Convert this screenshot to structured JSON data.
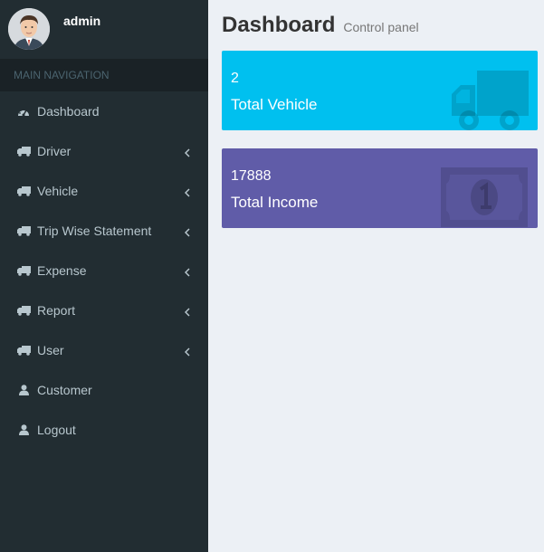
{
  "user": {
    "name": "admin"
  },
  "nav": {
    "header": "MAIN NAVIGATION",
    "items": [
      {
        "label": "Dashboard",
        "icon": "dashboard-icon",
        "has_children": false
      },
      {
        "label": "Driver",
        "icon": "truck-icon",
        "has_children": true
      },
      {
        "label": "Vehicle",
        "icon": "truck-icon",
        "has_children": true
      },
      {
        "label": "Trip Wise Statement",
        "icon": "truck-icon",
        "has_children": true
      },
      {
        "label": "Expense",
        "icon": "truck-icon",
        "has_children": true
      },
      {
        "label": "Report",
        "icon": "truck-icon",
        "has_children": true
      },
      {
        "label": "User",
        "icon": "truck-icon",
        "has_children": true
      },
      {
        "label": "Customer",
        "icon": "user-icon",
        "has_children": false
      },
      {
        "label": "Logout",
        "icon": "user-icon",
        "has_children": false
      }
    ]
  },
  "header": {
    "title": "Dashboard",
    "subtitle": "Control panel"
  },
  "boxes": [
    {
      "value": "2",
      "label": "Total Vehicle",
      "icon": "truck-icon",
      "color": "#00c0ef"
    },
    {
      "value": "17888",
      "label": "Total Income",
      "icon": "money-icon",
      "color": "#605ca8"
    }
  ],
  "colors": {
    "sidebar_bg": "#222d32",
    "sidebar_text": "#b8c7ce",
    "content_bg": "#ecf0f5"
  }
}
